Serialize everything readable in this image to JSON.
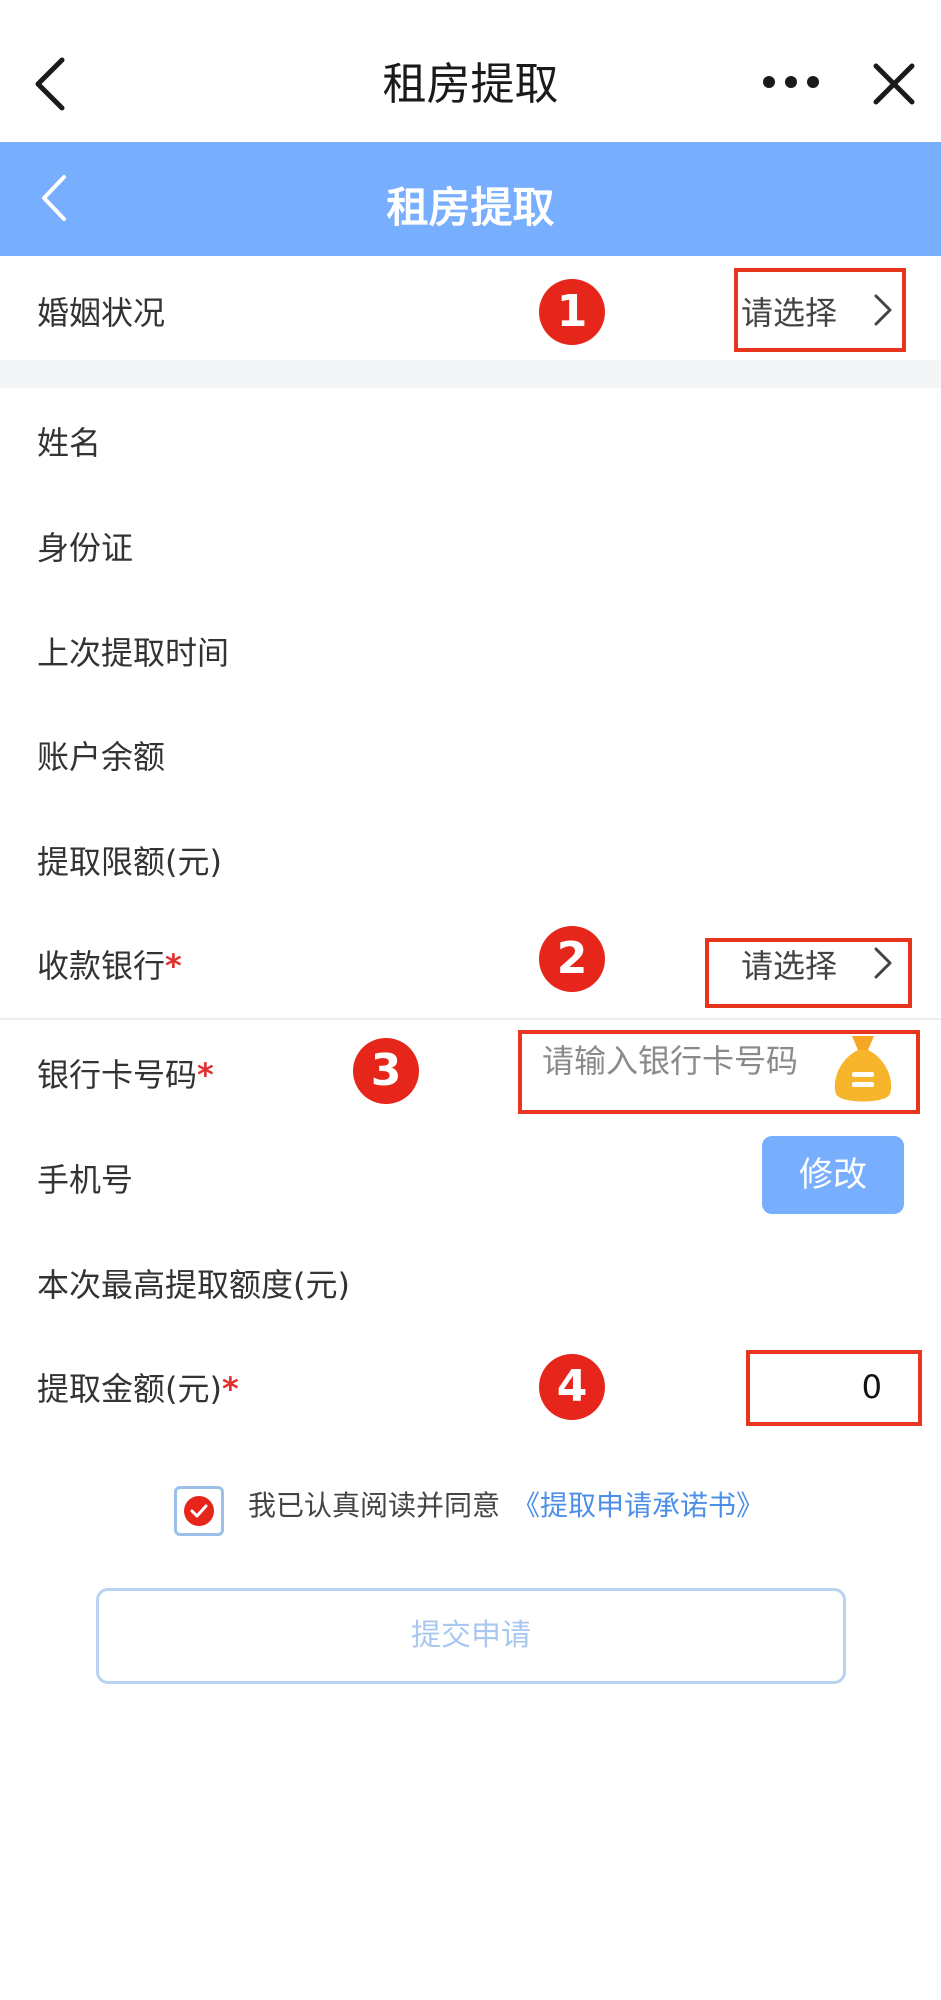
{
  "app_bar": {
    "title": "租房提取"
  },
  "header": {
    "title": "租房提取"
  },
  "form": {
    "marital_status": {
      "label": "婚姻状况",
      "value": "请选择"
    },
    "name": {
      "label": "姓名"
    },
    "id_card": {
      "label": "身份证"
    },
    "last_withdrawal_time": {
      "label": "上次提取时间"
    },
    "account_balance": {
      "label": "账户余额"
    },
    "withdrawal_limit": {
      "label": "提取限额(元)"
    },
    "payee_bank": {
      "label": "收款银行",
      "required_mark": "*",
      "value": "请选择"
    },
    "bank_card_number": {
      "label": "银行卡号码",
      "required_mark": "*",
      "placeholder": "请输入银行卡号码"
    },
    "phone": {
      "label": "手机号",
      "modify_label": "修改"
    },
    "max_withdrawal_amount": {
      "label": "本次最高提取额度(元)"
    },
    "withdrawal_amount": {
      "label": "提取金额(元)",
      "required_mark": "*",
      "value": "0"
    }
  },
  "agreement": {
    "checked": true,
    "text": "我已认真阅读并同意",
    "link": "《提取申请承诺书》"
  },
  "submit_label": "提交申请",
  "annotations": [
    "1",
    "2",
    "3",
    "4"
  ],
  "colors": {
    "accent": "#77aefd",
    "marker": "#e7261b",
    "link": "#4d8fe8",
    "required": "#e23030"
  }
}
